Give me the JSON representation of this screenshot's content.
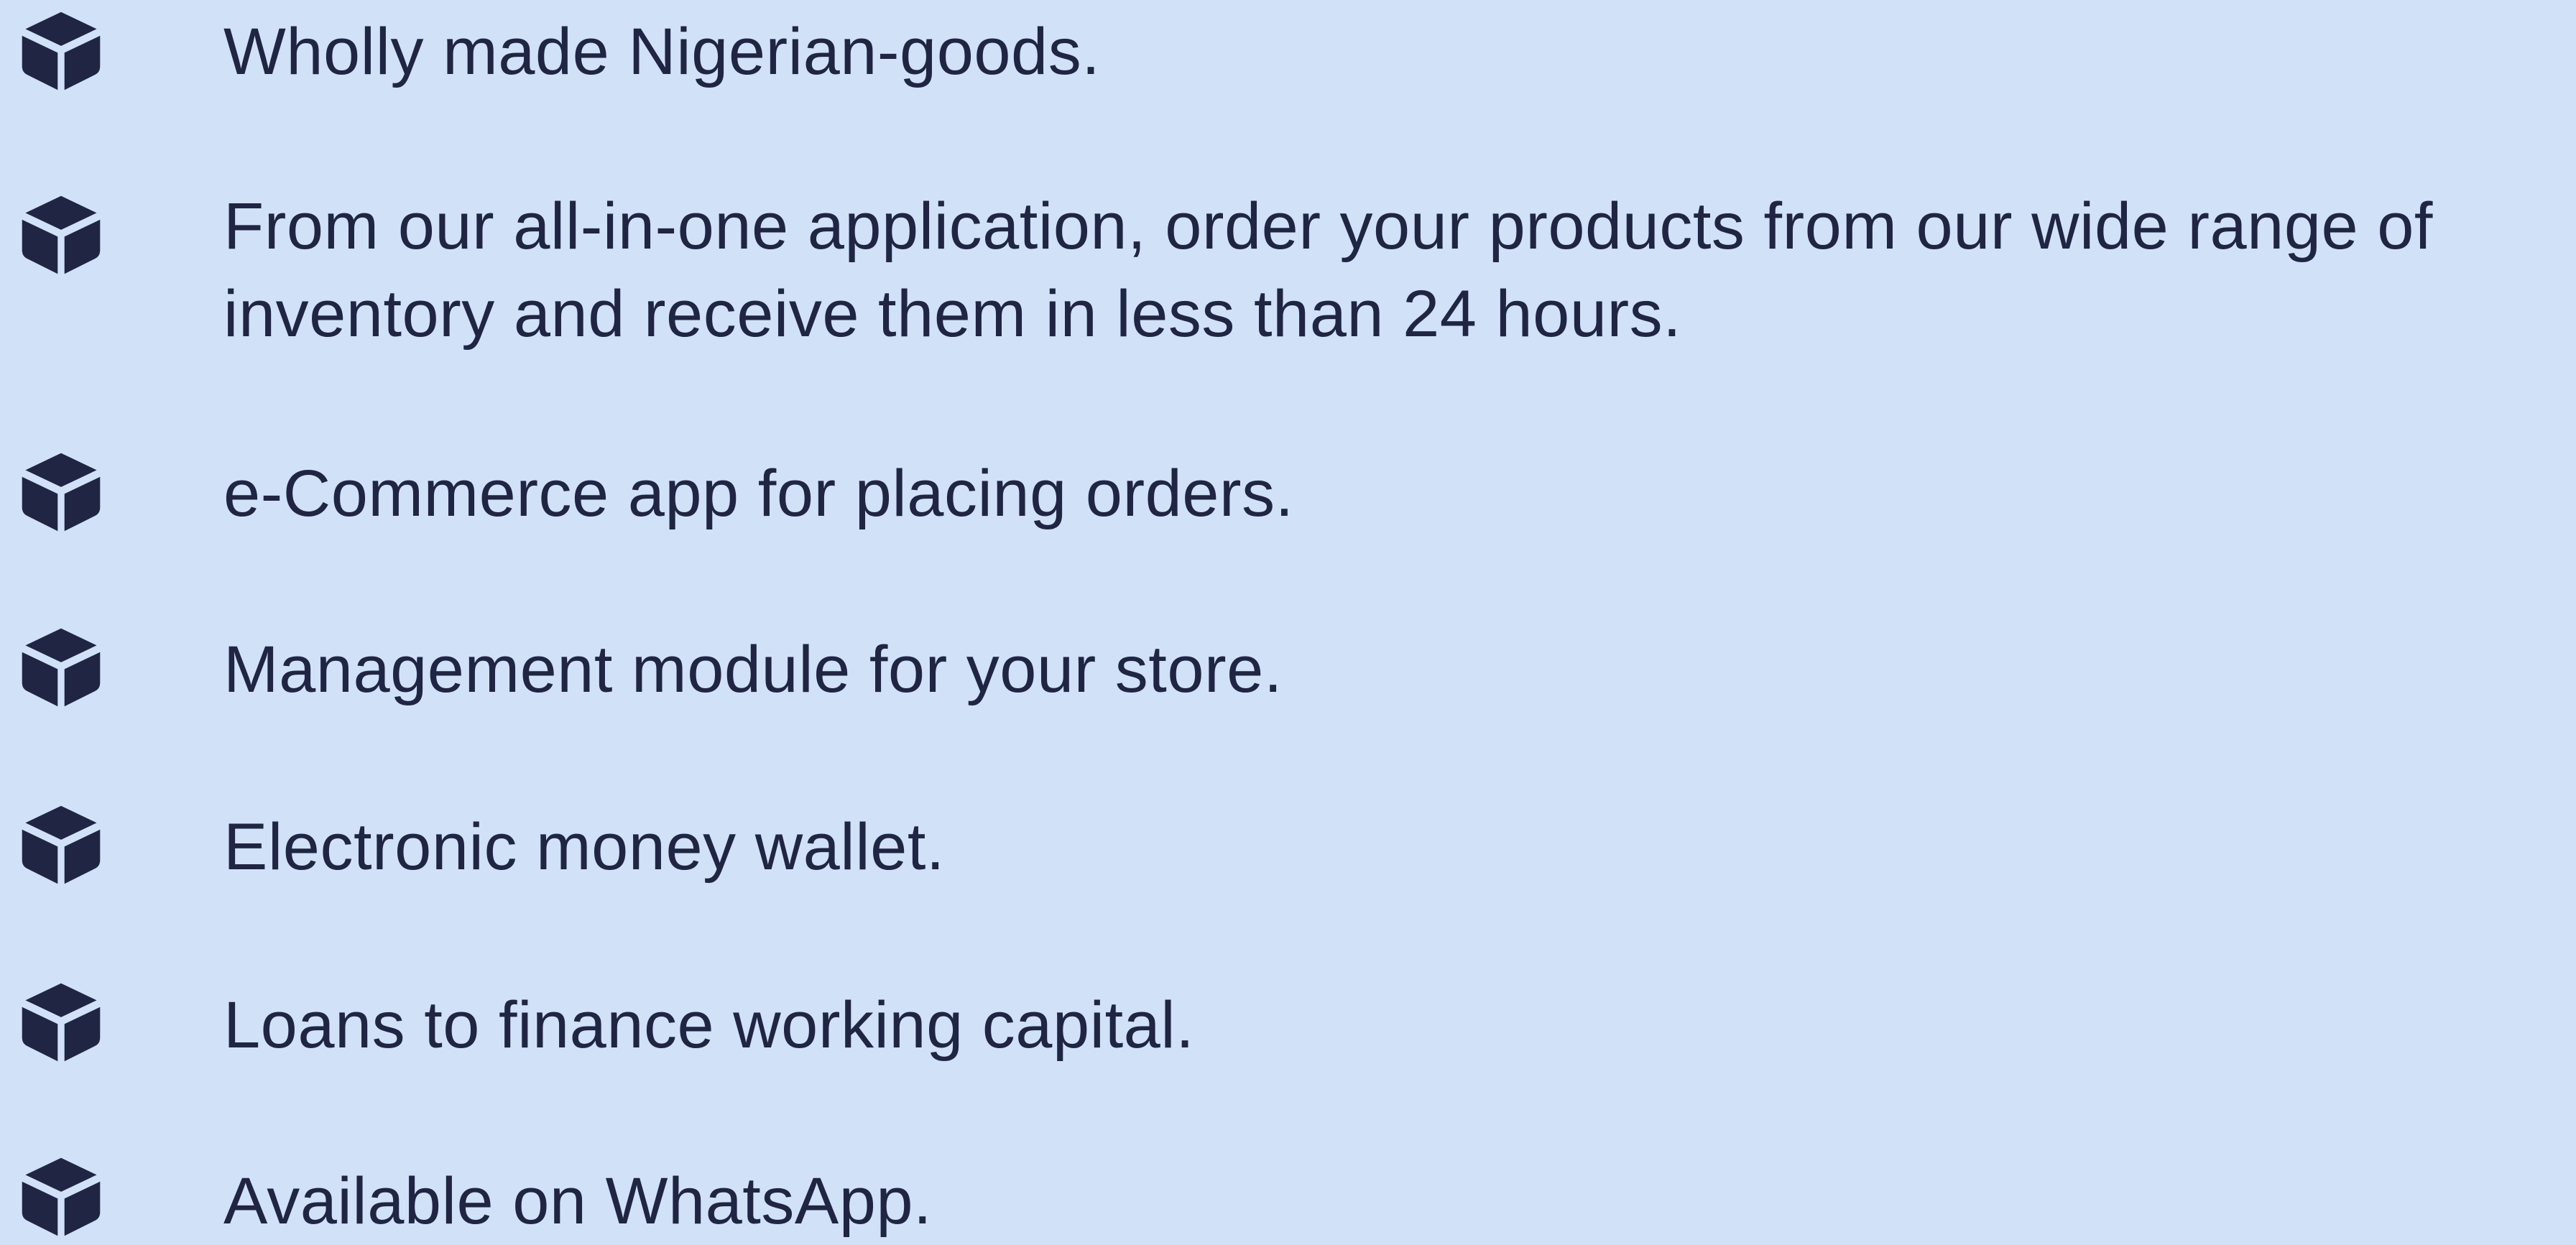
{
  "colors": {
    "background": "#d1e1f8",
    "text": "#1f2542",
    "icon": "#1f2542"
  },
  "features": {
    "icon": "cube-icon",
    "items": [
      {
        "text": "Wholly made Nigerian-goods."
      },
      {
        "text": "From our all-in-one application, order your products from our wide range of inventory and receive them in less than 24 hours."
      },
      {
        "text": "e-Commerce app for placing orders."
      },
      {
        "text": "Management module for your store."
      },
      {
        "text": "Electronic money wallet."
      },
      {
        "text": "Loans to finance working capital."
      },
      {
        "text": "Available on WhatsApp."
      }
    ]
  }
}
